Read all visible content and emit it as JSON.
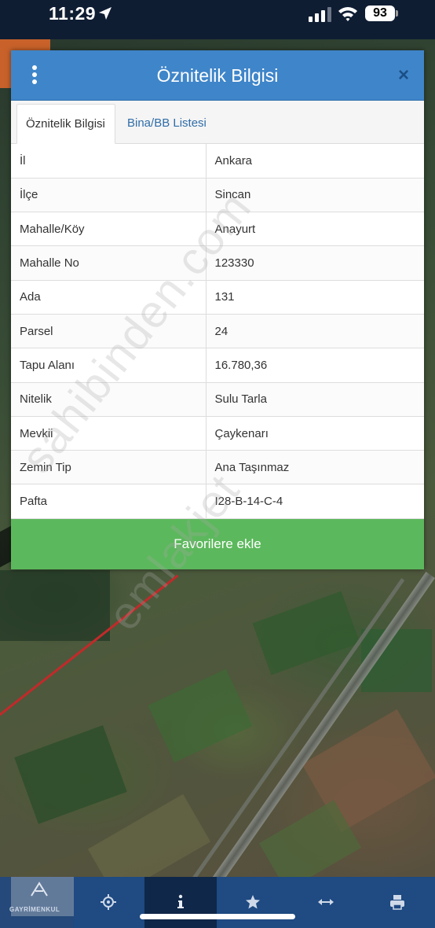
{
  "status_bar": {
    "time": "11:29",
    "battery": "93",
    "icons": [
      "location-arrow-icon",
      "signal-icon",
      "wifi-icon",
      "battery-icon"
    ]
  },
  "dialog": {
    "title": "Öznitelik Bilgisi",
    "close_label": "×",
    "tabs": [
      {
        "label": "Öznitelik Bilgisi",
        "active": true
      },
      {
        "label": "Bina/BB Listesi",
        "active": false
      }
    ],
    "rows": [
      {
        "key": "İl",
        "value": "Ankara"
      },
      {
        "key": "İlçe",
        "value": "Sincan"
      },
      {
        "key": "Mahalle/Köy",
        "value": "Anayurt"
      },
      {
        "key": "Mahalle No",
        "value": "123330"
      },
      {
        "key": "Ada",
        "value": "131"
      },
      {
        "key": "Parsel",
        "value": "24"
      },
      {
        "key": "Tapu Alanı",
        "value": "16.780,36"
      },
      {
        "key": "Nitelik",
        "value": "Sulu Tarla"
      },
      {
        "key": "Mevkii",
        "value": "Çaykenarı"
      },
      {
        "key": "Zemin Tip",
        "value": "Ana Taşınmaz"
      },
      {
        "key": "Pafta",
        "value": "I28-B-14-C-4"
      }
    ],
    "favorite_button": "Favorilere ekle"
  },
  "watermark": {
    "line1": "sahibinden.com",
    "line2": "emlakjet"
  },
  "toolbar": {
    "logo_text": "GAYRİMENKUL",
    "items": [
      "locate-icon",
      "info-icon",
      "star-icon",
      "measure-icon",
      "print-icon"
    ],
    "active": "info-icon"
  },
  "colors": {
    "header": "#3f85c9",
    "favorite": "#5cb85c",
    "toolbar": "#1f4a82",
    "tab_link": "#2f6da8"
  }
}
